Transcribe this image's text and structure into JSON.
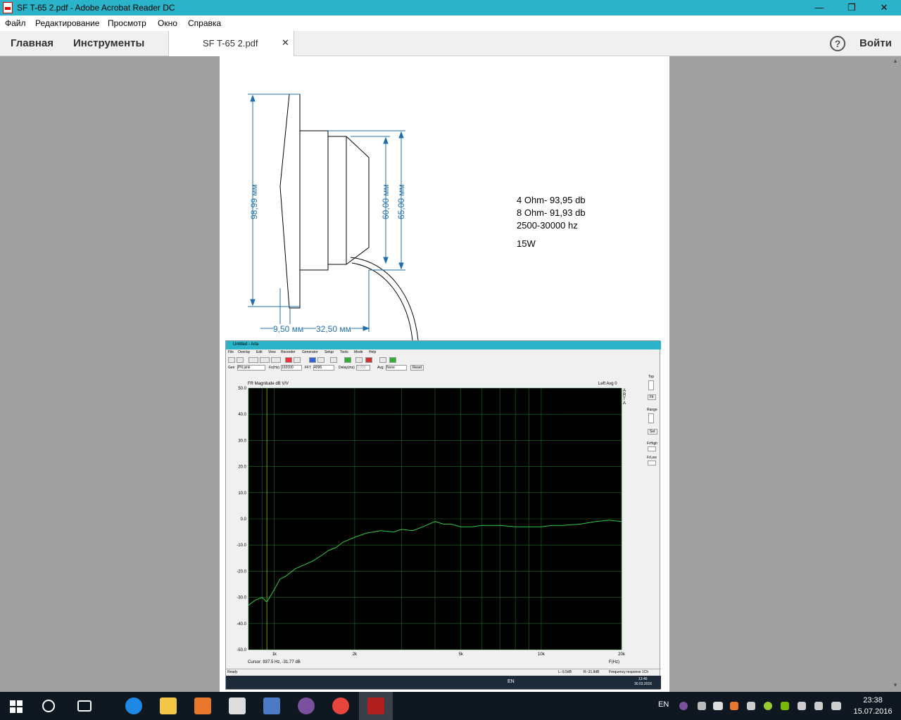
{
  "window": {
    "title": "SF T-65 2.pdf - Adobe Acrobat Reader DC",
    "minimize": "—",
    "restore": "❐",
    "close": "✕"
  },
  "menu": [
    "Файл",
    "Редактирование",
    "Просмотр",
    "Окно",
    "Справка"
  ],
  "toolbar": {
    "home": "Главная",
    "tools": "Инструменты",
    "doc_tab": "SF T-65 2.pdf",
    "tab_close": "✕",
    "help": "?",
    "signin": "Войти"
  },
  "drawing": {
    "dims": {
      "height_total": "98,99 мм",
      "height_inner": "60,00 мм",
      "height_outer": "65,00 мм",
      "depth_front": "9,50 мм",
      "depth_rear": "32,50 мм"
    },
    "specs": {
      "line1": "4 Ohm- 93,95 db",
      "line2": "8 Ohm- 91,93 db",
      "line3": "2500-30000 hz",
      "line4": "15W"
    }
  },
  "arta": {
    "title": "Untitled - Arta",
    "menu": [
      "File",
      "Overlay",
      "Edit",
      "View",
      "Recorder",
      "Generator",
      "Setup",
      "Tools",
      "Mode",
      "Help"
    ],
    "gen_row": {
      "gen_label": "Gen",
      "gen_value": "PN pink",
      "fs_label": "Fs(Hz)",
      "fs_value": "192000",
      "fft_label": "FFT",
      "fft_value": "4096",
      "delay_label": "Delay(ms)",
      "delay_value": "0.000",
      "avg_label": "Avg",
      "avg_value": "None",
      "reset": "Reset"
    },
    "plot_title": "FR Magnitude dB V/V",
    "plot_right": "Left  Avg 0",
    "brand": "ARTA",
    "cursor": "Cursor:   937.5 Hz, -31.77 dB",
    "xlabel": "F(Hz)",
    "side": {
      "top": "Top",
      "fit": "Fit",
      "range": "Range",
      "set": "Set",
      "frhigh": "FrHigh",
      "frlow": "FrLow"
    },
    "status": {
      "ready": "Ready",
      "l": "L:-9.5dB",
      "r": "R:-31.8dB",
      "mode": "Frequency response 1Ch"
    },
    "inner_taskbar": {
      "lang": "EN",
      "time": "13:46",
      "date": "30.03.2016"
    }
  },
  "chart_data": {
    "type": "line",
    "title": "FR Magnitude dB V/V",
    "xlabel": "F(Hz)",
    "ylabel": "",
    "xscale": "log",
    "xlim": [
      800,
      20000
    ],
    "ylim": [
      -50,
      50
    ],
    "xticks": [
      {
        "v": 1000,
        "l": "1k"
      },
      {
        "v": 2000,
        "l": "2k"
      },
      {
        "v": 5000,
        "l": "5k"
      },
      {
        "v": 10000,
        "l": "10k"
      },
      {
        "v": 20000,
        "l": "20k"
      }
    ],
    "yticks": [
      50,
      40,
      30,
      20,
      10,
      0,
      -10,
      -20,
      -30,
      -40,
      -50
    ],
    "ytick_labels": [
      "50.0",
      "40.0",
      "30.0",
      "20.0",
      "10.0",
      "0.0",
      "-10.0",
      "-20.0",
      "-30.0",
      "-40.0",
      "-50.0"
    ],
    "grid": true,
    "series": [
      {
        "color": "#2ecc40",
        "x": [
          800,
          850,
          900,
          937.5,
          1000,
          1050,
          1100,
          1200,
          1300,
          1400,
          1500,
          1600,
          1700,
          1800,
          2000,
          2200,
          2500,
          2800,
          3000,
          3300,
          3600,
          4000,
          4300,
          4600,
          5000,
          5500,
          6000,
          7000,
          8000,
          9000,
          10000,
          11000,
          12000,
          14000,
          16000,
          18000,
          20000
        ],
        "y": [
          -33,
          -31,
          -30,
          -31.77,
          -27,
          -23,
          -22,
          -19,
          -17.5,
          -16,
          -14,
          -12,
          -11,
          -9,
          -7,
          -5.5,
          -4.5,
          -5,
          -4,
          -4.5,
          -3,
          -1,
          -2,
          -2,
          -3,
          -3,
          -2.5,
          -2.5,
          -3,
          -3,
          -3,
          -2.5,
          -2.5,
          -2,
          -1,
          -0.5,
          -1
        ]
      }
    ]
  },
  "taskbar": {
    "lang": "EN",
    "time": "23:38",
    "date": "15.07.2016"
  },
  "colors": {
    "titlebar": "#2bb3c9",
    "dim_blue": "#1f6fb0",
    "plot_bg": "#000000",
    "grid": "#1f6b1f",
    "trace": "#2ecc40"
  }
}
